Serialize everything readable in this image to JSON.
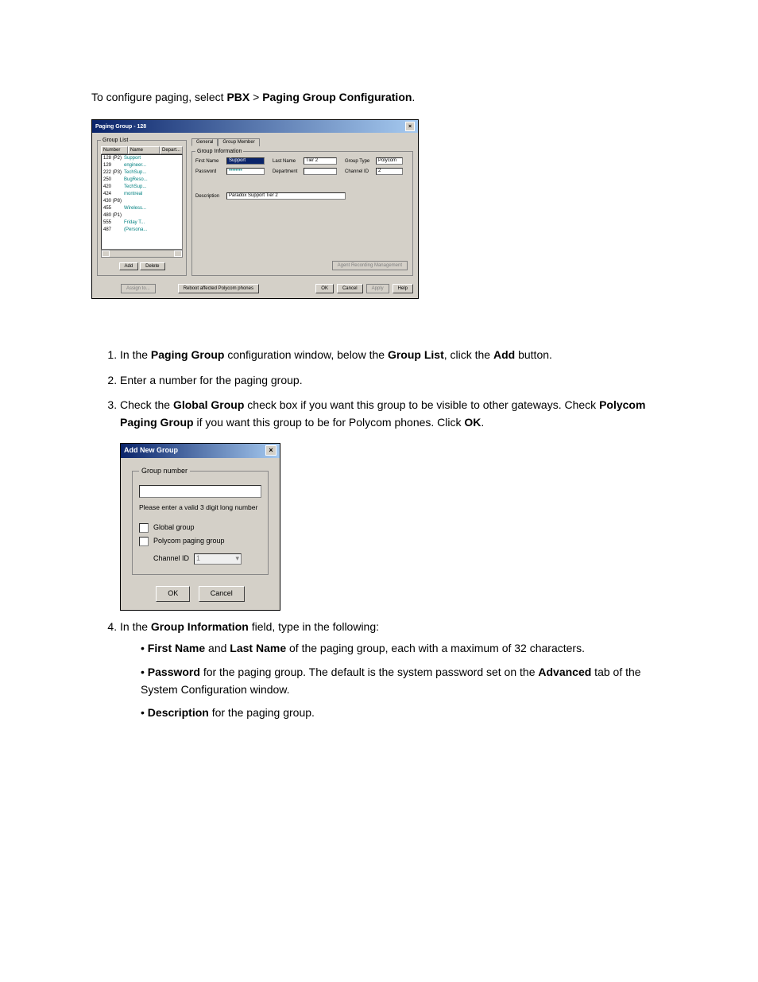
{
  "intro": {
    "pre": "To configure paging, select ",
    "i1": "PBX",
    "gt": " > ",
    "i2": "Paging Group Configuration",
    "post": "."
  },
  "fig1": {
    "title": "Paging Group - 128",
    "grouplist_legend": "Group List",
    "cols": {
      "number": "Number",
      "name": "Name",
      "dept": "Depart..."
    },
    "rows": [
      {
        "n": "128 (P2)",
        "name": "Support"
      },
      {
        "n": "129",
        "name": "engineer..."
      },
      {
        "n": "222 (P3)",
        "name": "TechSup..."
      },
      {
        "n": "250",
        "name": "BugReso..."
      },
      {
        "n": "420",
        "name": "TechSup..."
      },
      {
        "n": "424",
        "name": "montreal"
      },
      {
        "n": "430 (P8)",
        "name": ""
      },
      {
        "n": "455",
        "name": "Wireless..."
      },
      {
        "n": "480 (P1)",
        "name": ""
      },
      {
        "n": "555",
        "name": "Friday T..."
      },
      {
        "n": "487",
        "name": "(Persona..."
      }
    ],
    "add": "Add",
    "delete": "Delete",
    "assign": "Assign to...",
    "tabs": {
      "general": "General",
      "member": "Group Member"
    },
    "ginfo_legend": "Group Information",
    "fields": {
      "firstname_l": "First Name",
      "firstname_v": "Support",
      "lastname_l": "Last Name",
      "lastname_v": "Tier 2",
      "grouptype_l": "Group Type",
      "grouptype_v": "Polycom",
      "password_l": "Password",
      "password_v": "••••••••",
      "department_l": "Department",
      "department_v": "",
      "channel_l": "Channel ID",
      "channel_v": "2",
      "description_l": "Description",
      "description_v": "Paradox Support Tier 2"
    },
    "agent_btn": "Agent Recording Management",
    "footer": {
      "reboot": "Reboot affected Polycom phones",
      "ok": "OK",
      "cancel": "Cancel",
      "apply": "Apply",
      "help": "Help"
    }
  },
  "step1": {
    "p1": "In the ",
    "b1": "Paging Group",
    "p2": " configuration window, below the ",
    "b2": "Group List",
    "p3": ", click the ",
    "b3": "Add",
    "p4": " button."
  },
  "step2": "Enter a number for the paging group.",
  "step3": {
    "p1": "Check the ",
    "b1": "Global Group",
    "p2": " check box if you want this group to be visible to other gateways. Check ",
    "b2": "Polycom Paging Group",
    "p3": " if you want this group to be for Polycom phones. Click ",
    "b3": "OK",
    "p4": "."
  },
  "fig2": {
    "title": "Add New Group",
    "legend": "Group number",
    "hint": "Please enter a valid 3 digit long number",
    "global": "Global group",
    "poly": "Polycom paging group",
    "chan_l": "Channel ID",
    "chan_v": "1",
    "ok": "OK",
    "cancel": "Cancel"
  },
  "step4": {
    "p1": "In the ",
    "b1": "Group Information",
    "p2": " field, type in the following:"
  },
  "b4a": {
    "b1": "First Name",
    "mid": " and ",
    "b2": "Last Name",
    "tail": " of the paging group, each with a maximum of 32 characters."
  },
  "b4b": {
    "b1": "Password",
    "p1": " for the paging group. The default is the system password set on the ",
    "b2": "Advanced",
    "p2": " tab of the System Configuration window."
  },
  "b4c": {
    "b1": "Description",
    "p1": " for the paging group."
  }
}
